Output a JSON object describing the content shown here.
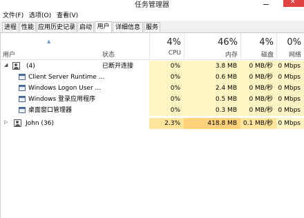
{
  "window": {
    "title": "任务管理器"
  },
  "menu": [
    "文件(F)",
    "选项(O)",
    "查看(V)"
  ],
  "tabs": [
    "进程",
    "性能",
    "应用历史记录",
    "启动",
    "用户",
    "详细信息",
    "服务"
  ],
  "columns": {
    "user": "用户",
    "status": "状态",
    "cpu": {
      "pct": "4%",
      "label": "CPU"
    },
    "mem": {
      "pct": "46%",
      "label": "内存"
    },
    "disk": {
      "pct": "4%",
      "label": "磁盘"
    },
    "net": {
      "pct": "0%",
      "label": "网络"
    }
  },
  "groups": [
    {
      "name": "(4)",
      "status": "已断开连接",
      "cpu": "0%",
      "mem": "3.8 MB",
      "disk": "0 MB/秒",
      "net": "0 Mbps",
      "processes": [
        {
          "name": "Client Server Runtime ...",
          "cpu": "0%",
          "mem": "0.6 MB",
          "disk": "0 MB/秒",
          "net": "0 Mbps"
        },
        {
          "name": "Windows Logon User ...",
          "cpu": "0%",
          "mem": "2.4 MB",
          "disk": "0 MB/秒",
          "net": "0 Mbps"
        },
        {
          "name": "Windows 登录应用程序",
          "cpu": "0%",
          "mem": "0.5 MB",
          "disk": "0 MB/秒",
          "net": "0 Mbps"
        },
        {
          "name": "桌面窗口管理器",
          "cpu": "0%",
          "mem": "0.3 MB",
          "disk": "0 MB/秒",
          "net": "0 Mbps"
        }
      ]
    },
    {
      "name": "John (36)",
      "status": "",
      "cpu": "2.3%",
      "mem": "418.8 MB",
      "disk": "0.1 MB/秒",
      "net": "0 Mbps"
    }
  ]
}
